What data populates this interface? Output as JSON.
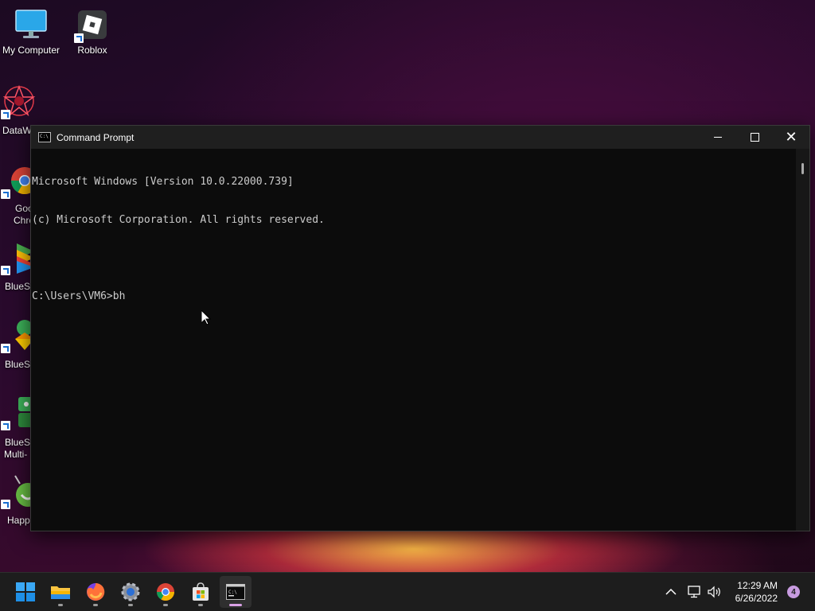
{
  "desktop": {
    "icons": [
      {
        "label": "My Computer",
        "icon": "monitor-icon"
      },
      {
        "label": "Roblox",
        "icon": "roblox-icon"
      },
      {
        "label": "DataW",
        "icon": "datawin-icon"
      },
      {
        "label": "Goo",
        "label2": "Chro",
        "icon": "chrome-icon"
      },
      {
        "label": "BlueSt",
        "icon": "bluestacks-icon"
      },
      {
        "label": "BlueSt",
        "icon": "bluestacks-x-icon"
      },
      {
        "label": "BlueSt",
        "label2": "Multi-",
        "icon": "bluestacks-multi-icon"
      },
      {
        "label": "Happ",
        "icon": "happymod-icon"
      }
    ]
  },
  "window": {
    "title": "Command Prompt",
    "lines": [
      "Microsoft Windows [Version 10.0.22000.739]",
      "(c) Microsoft Corporation. All rights reserved.",
      "",
      "C:\\Users\\VM6>bh"
    ]
  },
  "taskbar": {
    "items": [
      "start-icon",
      "file-explorer-icon",
      "firefox-icon",
      "settings-icon",
      "chrome-icon",
      "store-icon",
      "terminal-icon"
    ],
    "active_item": "terminal-icon",
    "time": "12:29 AM",
    "date": "6/26/2022",
    "notification_count": "4"
  },
  "colors": {
    "console_bg": "#0c0c0c",
    "console_text": "#cccccc",
    "taskbar_bg": "#1d1d1d",
    "accent": "#d9a0e5"
  }
}
